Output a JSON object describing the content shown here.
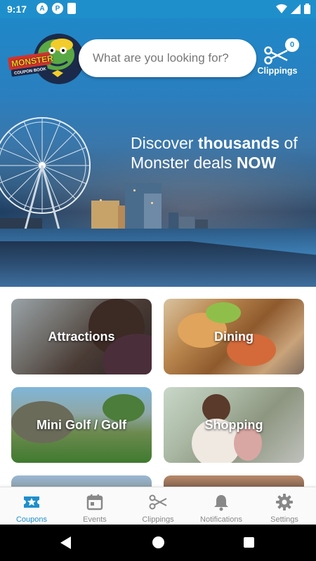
{
  "status_bar": {
    "time": "9:17",
    "notification_icons": [
      "a-circle-icon",
      "p-circle-icon",
      "sd-card-icon"
    ],
    "right_icons": [
      "wifi-icon",
      "signal-icon",
      "battery-icon"
    ]
  },
  "header": {
    "logo_text_top": "MONSTER",
    "logo_text_bottom": "COUPON BOOK",
    "search_placeholder": "What are you looking for?",
    "clippings_label": "Clippings",
    "clippings_count": "0"
  },
  "hero": {
    "tagline_part1": "Discover ",
    "tagline_bold1": "thousands",
    "tagline_part2": " of Monster deals ",
    "tagline_bold2": "NOW"
  },
  "categories": [
    {
      "label": "Attractions"
    },
    {
      "label": "Dining"
    },
    {
      "label": "Mini Golf / Golf"
    },
    {
      "label": "Shopping"
    }
  ],
  "bottom_nav": {
    "items": [
      {
        "label": "Coupons",
        "icon": "coupon-star-icon",
        "active": true
      },
      {
        "label": "Events",
        "icon": "calendar-icon",
        "active": false
      },
      {
        "label": "Clippings",
        "icon": "scissors-icon",
        "active": false
      },
      {
        "label": "Notifications",
        "icon": "bell-icon",
        "active": false
      },
      {
        "label": "Settings",
        "icon": "gear-icon",
        "active": false
      }
    ]
  },
  "colors": {
    "brand": "#1f8fcc",
    "inactive": "#888888"
  }
}
